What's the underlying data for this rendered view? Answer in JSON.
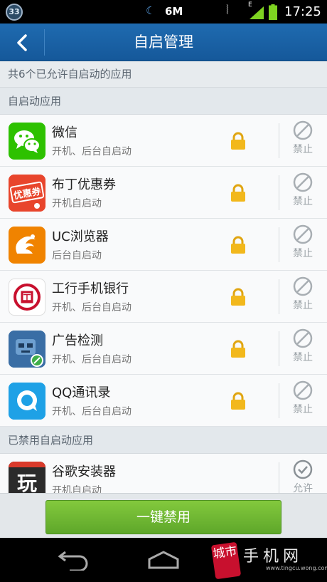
{
  "status_bar": {
    "notification_count": "33",
    "data_label": "6M",
    "network_label": "E",
    "time": "17:25",
    "icons": [
      "notification-badge",
      "moon-icon",
      "vibrate-icon",
      "signal-icon",
      "battery-icon"
    ]
  },
  "header": {
    "title": "自启管理",
    "back_icon": "chevron-left-icon"
  },
  "summary_text": "共6个已允许自启动的应用",
  "sections": {
    "allowed_title": "自启动应用",
    "disabled_title": "已禁用自启动应用"
  },
  "allowed_apps": [
    {
      "name": "微信",
      "desc": "开机、后台自启动",
      "action": "禁止",
      "icon": "wechat-icon"
    },
    {
      "name": "布丁优惠券",
      "desc": "开机自启动",
      "action": "禁止",
      "icon": "coupon-icon"
    },
    {
      "name": "UC浏览器",
      "desc": "后台自启动",
      "action": "禁止",
      "icon": "uc-browser-icon"
    },
    {
      "name": "工行手机银行",
      "desc": "开机、后台自启动",
      "action": "禁止",
      "icon": "icbc-icon"
    },
    {
      "name": "广告检测",
      "desc": "开机、后台自启动",
      "action": "禁止",
      "icon": "ad-detect-icon"
    },
    {
      "name": "QQ通讯录",
      "desc": "开机、后台自启动",
      "action": "禁止",
      "icon": "qq-contacts-icon"
    }
  ],
  "disabled_apps": [
    {
      "name": "谷歌安装器",
      "desc": "开机自启动",
      "action": "允许",
      "icon": "google-installer-icon"
    }
  ],
  "coupon_icon_text": "优惠券",
  "icbc_icon_text": "工",
  "google_installer_icon_text": "玩",
  "footer": {
    "disable_all_label": "一键禁用"
  },
  "watermark": {
    "badge": "城市",
    "text": "手机网",
    "url": "www.tingcu.wong.com"
  },
  "colors": {
    "title_bar": "#1a62a6",
    "primary_button": "#6cb533",
    "lock": "#f2b81c"
  }
}
